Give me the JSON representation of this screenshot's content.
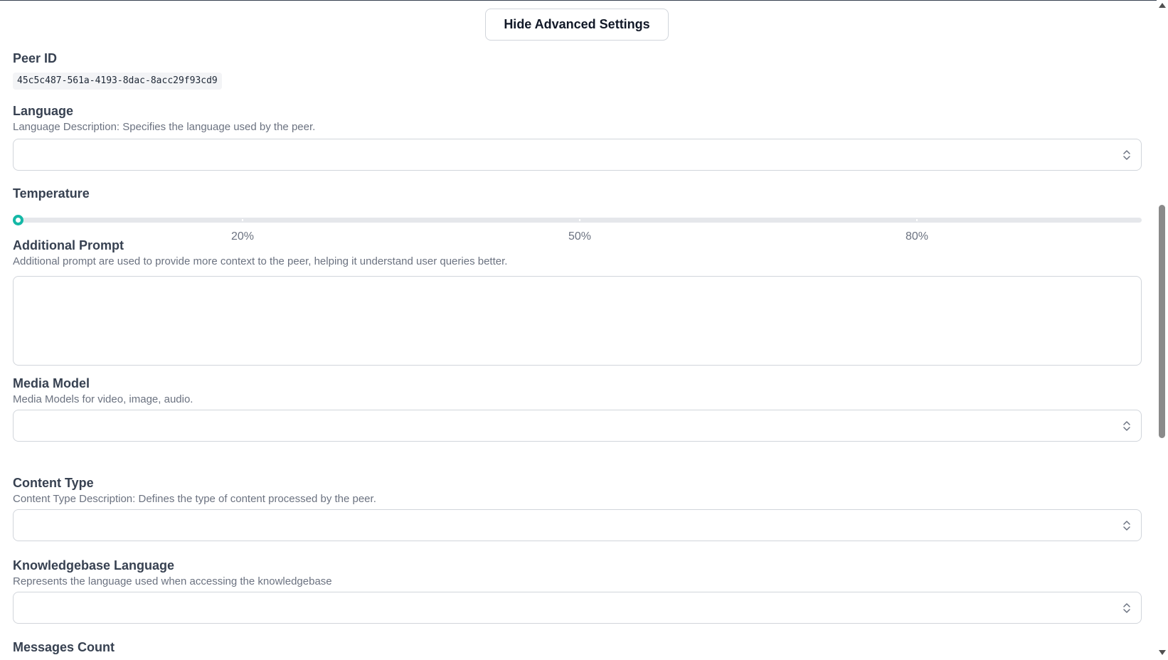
{
  "header": {
    "toggle_label": "Hide Advanced Settings"
  },
  "peer_id": {
    "label": "Peer ID",
    "value": "45c5c487-561a-4193-8dac-8acc29f93cd9"
  },
  "language": {
    "label": "Language",
    "description": "Language Description: Specifies the language used by the peer.",
    "value": ""
  },
  "temperature": {
    "label": "Temperature",
    "value_percent": 0,
    "marks": [
      {
        "value": 20,
        "label": "20%"
      },
      {
        "value": 50,
        "label": "50%"
      },
      {
        "value": 80,
        "label": "80%"
      }
    ],
    "accent_color": "#14b8a6"
  },
  "additional_prompt": {
    "label": "Additional Prompt",
    "description": "Additional prompt are used to provide more context to the peer, helping it understand user queries better.",
    "value": ""
  },
  "media_model": {
    "label": "Media Model",
    "description": "Media Models for video, image, audio.",
    "value": ""
  },
  "content_type": {
    "label": "Content Type",
    "description": "Content Type Description: Defines the type of content processed by the peer.",
    "value": ""
  },
  "knowledgebase_language": {
    "label": "Knowledgebase Language",
    "description": "Represents the language used when accessing the knowledgebase",
    "value": ""
  },
  "messages_count": {
    "label": "Messages Count"
  },
  "icons": {
    "select_indicator": "chevron-up-down-icon",
    "scroll_up": "scroll-up-arrow-icon",
    "scroll_down": "scroll-down-arrow-icon"
  }
}
